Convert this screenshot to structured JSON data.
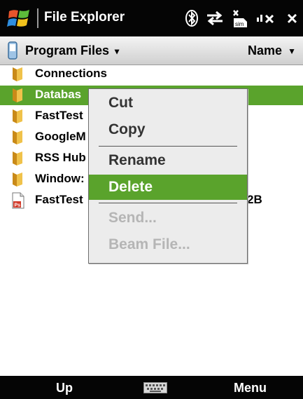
{
  "titlebar": {
    "title": "File Explorer",
    "icons": [
      "windows-start-icon",
      "bluetooth-icon",
      "data-sync-arrows-icon",
      "no-sim-icon",
      "volume-muted-icon"
    ],
    "close_label": "×"
  },
  "pathbar": {
    "folder": "Program Files",
    "sort": "Name",
    "caret": "▼"
  },
  "files": [
    {
      "name": "Connections",
      "type": "folder",
      "size": ""
    },
    {
      "name": "Databas",
      "type": "folder",
      "size": "",
      "selected": true
    },
    {
      "name": "FastTest",
      "type": "folder",
      "size": ""
    },
    {
      "name": "GoogleM",
      "type": "folder",
      "size": ""
    },
    {
      "name": "RSS Hub",
      "type": "folder",
      "size": ""
    },
    {
      "name": "Window:",
      "type": "folder",
      "size": ""
    },
    {
      "name": "FastTest",
      "type": "file",
      "size": "2B"
    }
  ],
  "context_menu": {
    "items": [
      {
        "label": "Cut",
        "enabled": true
      },
      {
        "label": "Copy",
        "enabled": true
      },
      {
        "label": "Rename",
        "enabled": true
      },
      {
        "label": "Delete",
        "enabled": true,
        "highlighted": true
      },
      {
        "label": "Send...",
        "enabled": false
      },
      {
        "label": "Beam File...",
        "enabled": false
      }
    ]
  },
  "softkeys": {
    "left": "Up",
    "center_icon": "keyboard-icon",
    "right": "Menu"
  },
  "colors": {
    "selection": "#5aa32c",
    "titlebar": "#050505",
    "folder": "#e8b33a"
  }
}
